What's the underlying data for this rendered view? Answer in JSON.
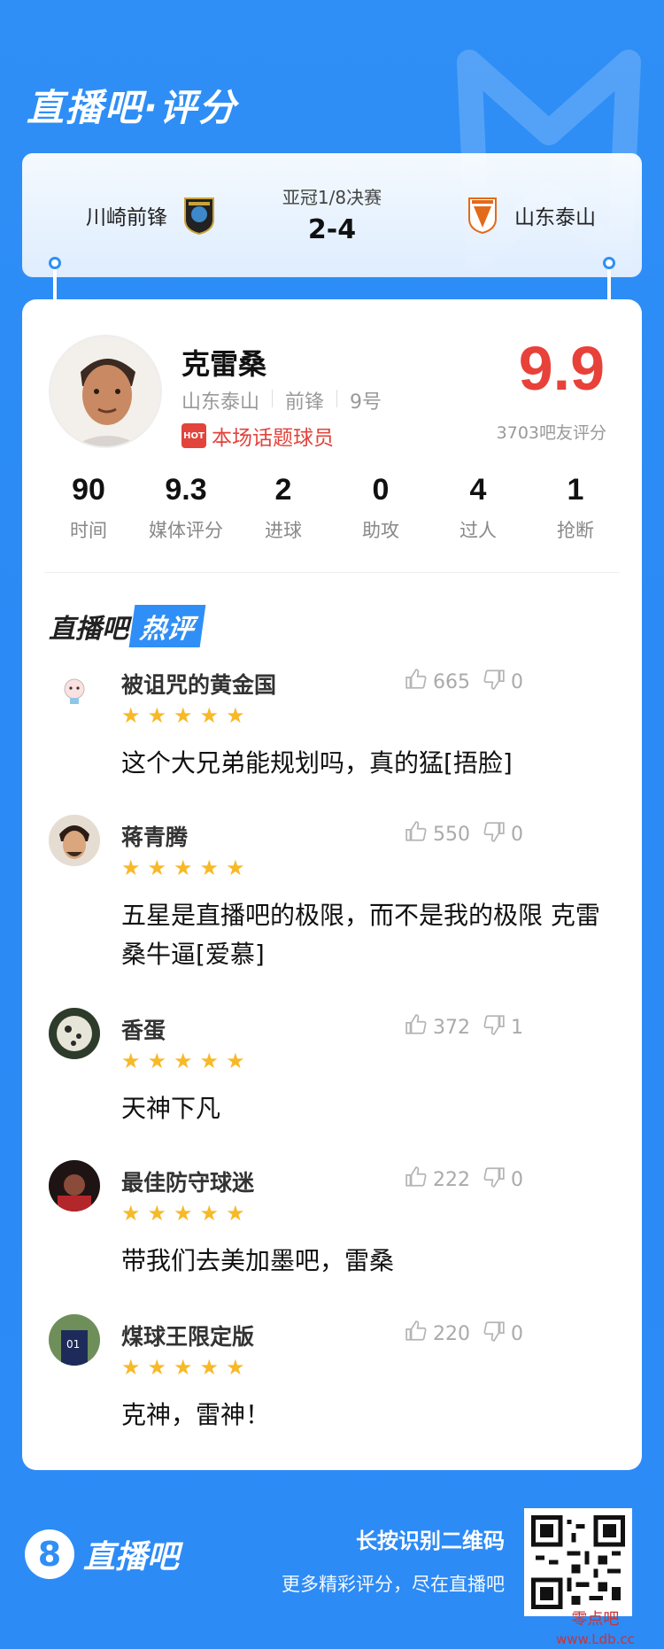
{
  "header": {
    "title": "直播吧·评分"
  },
  "match": {
    "home_team": "川崎前锋",
    "away_team": "山东泰山",
    "stage": "亚冠1/8决赛",
    "score": "2-4"
  },
  "player": {
    "name": "克雷桑",
    "team": "山东泰山",
    "position": "前锋",
    "number": "9号",
    "hot_label": "本场话题球员",
    "hot_badge": "HOT",
    "rating": "9.9",
    "rating_sub": "3703吧友评分"
  },
  "stats": [
    {
      "value": "90",
      "label": "时间"
    },
    {
      "value": "9.3",
      "label": "媒体评分"
    },
    {
      "value": "2",
      "label": "进球"
    },
    {
      "value": "0",
      "label": "助攻"
    },
    {
      "value": "4",
      "label": "过人"
    },
    {
      "value": "1",
      "label": "抢断"
    }
  ],
  "hot_comments": {
    "title_prefix": "直播吧",
    "title_tag": "热评",
    "items": [
      {
        "user": "被诅咒的黄金国",
        "likes": "665",
        "dislikes": "0",
        "stars": 5,
        "text": "这个大兄弟能规划吗，真的猛[捂脸]"
      },
      {
        "user": "蒋青腾",
        "likes": "550",
        "dislikes": "0",
        "stars": 5,
        "text": "五星是直播吧的极限，而不是我的极限 克雷桑牛逼[爱慕]"
      },
      {
        "user": "香蛋",
        "likes": "372",
        "dislikes": "1",
        "stars": 5,
        "text": "天神下凡"
      },
      {
        "user": "最佳防守球迷",
        "likes": "222",
        "dislikes": "0",
        "stars": 5,
        "text": "带我们去美加墨吧，雷桑"
      },
      {
        "user": "煤球王限定版",
        "likes": "220",
        "dislikes": "0",
        "stars": 5,
        "text": "克神，雷神！"
      }
    ]
  },
  "footer": {
    "logo_text": "直播吧",
    "logo_mark": "8",
    "cta_line1": "长按识别二维码",
    "cta_line2": "更多精彩评分，尽在直播吧"
  },
  "watermark": {
    "line1": "零点吧",
    "line2": "www.Ldb.cc"
  },
  "colors": {
    "brand_blue": "#2f8ff6",
    "rating_red": "#e8413a",
    "star_gold": "#f7b928",
    "hot_red": "#e2433b"
  }
}
